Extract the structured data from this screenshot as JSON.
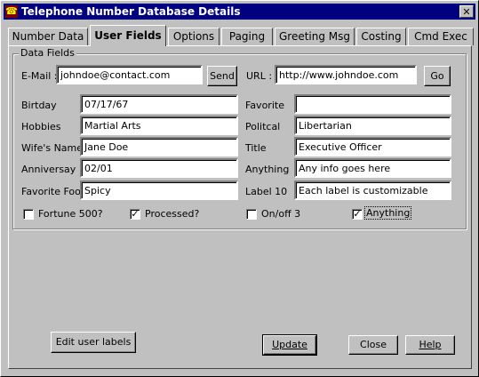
{
  "window": {
    "title": "Telephone Number Database Details",
    "icon": "app-icon",
    "close_label": "✕"
  },
  "tabs": [
    "Number Data",
    "User Fields",
    "Options",
    "Paging",
    "Greeting Msg",
    "Costing",
    "Cmd Exec"
  ],
  "active_tab": "User Fields",
  "group": {
    "label": "Data Fields"
  },
  "email": {
    "label": "E-Mail :",
    "value": "johndoe@contact.com",
    "button": "Send"
  },
  "url": {
    "label": "URL :",
    "value": "http://www.johndoe.com",
    "button": "Go"
  },
  "left_fields": [
    {
      "label": "Birtday",
      "value": "07/17/67"
    },
    {
      "label": "Hobbies",
      "value": "Martial Arts"
    },
    {
      "label": "Wife's Name",
      "value": "Jane Doe"
    },
    {
      "label": "Anniversay",
      "value": "02/01"
    },
    {
      "label": "Favorite Food",
      "value": "Spicy"
    }
  ],
  "right_fields": [
    {
      "label": "Favorite",
      "value": ""
    },
    {
      "label": "Politcal",
      "value": "Libertarian"
    },
    {
      "label": "Title",
      "value": "Executive Officer"
    },
    {
      "label": "Anything",
      "value": "Any info goes here"
    },
    {
      "label": "Label 10",
      "value": "Each label is customizable"
    }
  ],
  "checkboxes": [
    {
      "label": "Fortune 500?",
      "checked": false
    },
    {
      "label": "Processed?",
      "checked": true
    },
    {
      "label": "On/off 3",
      "checked": false
    },
    {
      "label": "Anything",
      "checked": true
    }
  ],
  "buttons": {
    "edit_labels": "Edit user labels",
    "update": "Update",
    "close": "Close",
    "help": "Help"
  }
}
